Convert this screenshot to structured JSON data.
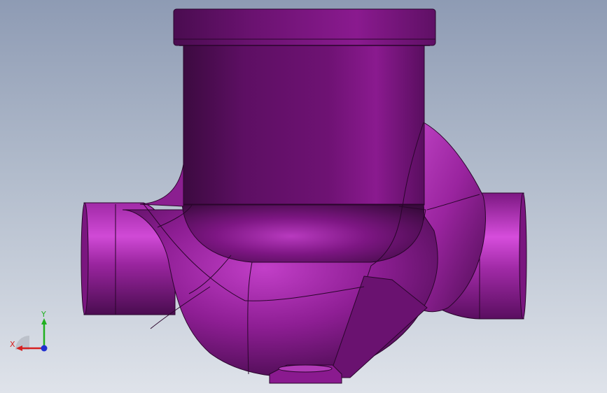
{
  "viewport": {
    "background_top": "#8e9bb4",
    "background_bottom": "#dfe3ea"
  },
  "model": {
    "color": "#8b1f8f",
    "highlight_color": "#c63ccc",
    "shadow_color": "#3a0a3c"
  },
  "triad": {
    "x_label": "X",
    "y_label": "Y",
    "x_color": "#d62020",
    "y_color": "#20b020",
    "z_color": "#2030d0"
  }
}
